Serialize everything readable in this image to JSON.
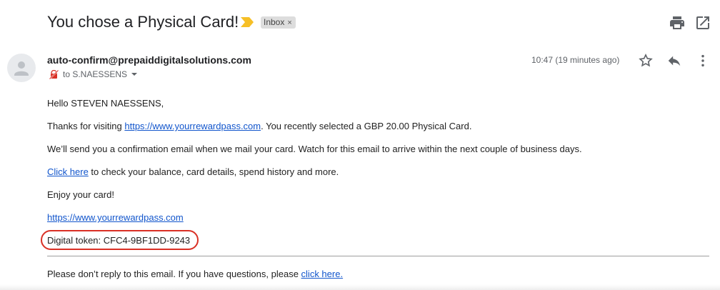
{
  "email": {
    "subject": "You chose a Physical Card!",
    "label_chip": "Inbox",
    "label_chip_close": "×",
    "sender": "auto-confirm@prepaiddigitalsolutions.com",
    "recipient": "to S.NAESSENS",
    "timestamp": "10:47 (19 minutes ago)"
  },
  "body": {
    "greeting": "Hello STEVEN NAESSENS,",
    "visit_prefix": "Thanks for visiting ",
    "visit_link": "https://www.yourrewardpass.com",
    "visit_suffix": ". You recently selected a GBP 20.00 Physical Card.",
    "confirmation": "We’ll send you a confirmation email when we mail your card. Watch for this email to arrive within the next couple of business days.",
    "click_link": "Click here",
    "click_suffix": " to check your balance, card details, spend history and more.",
    "enjoy": "Enjoy your card!",
    "footer_link": "https://www.yourrewardpass.com",
    "token": "Digital token: CFC4-9BF1DD-9243",
    "reply_notice": "Please don’t reply to this email. If you have questions, please ",
    "reply_link": "click here."
  },
  "icons": {
    "important": "important-marker-icon",
    "print": "print-icon",
    "open_new_window": "open-in-new-window-icon",
    "avatar": "default-avatar-icon",
    "not_encrypted": "not-encrypted-icon",
    "star": "star-icon",
    "reply": "reply-icon",
    "more": "more-vertical-icon"
  },
  "colors": {
    "link": "#1155cc",
    "important_marker": "#f6bf26",
    "token_highlight": "#d93025",
    "chip_bg": "#dddddd"
  }
}
